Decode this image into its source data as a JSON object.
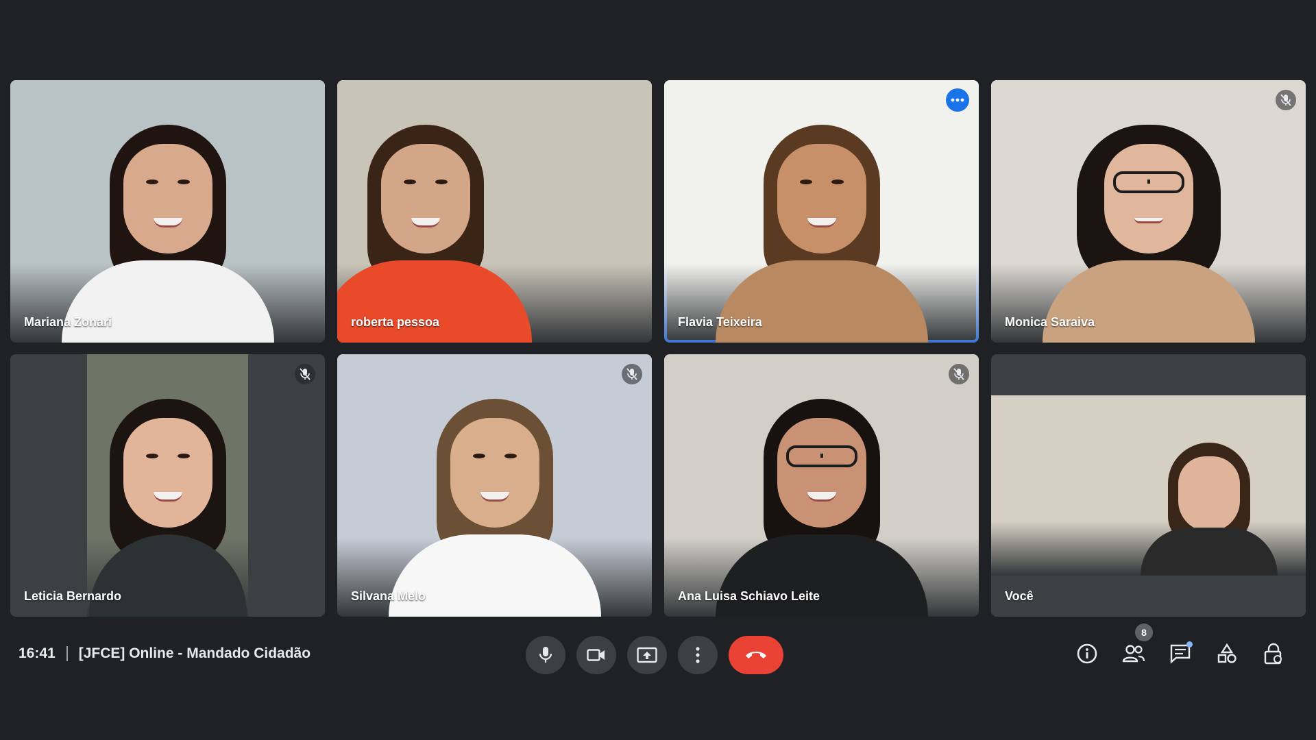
{
  "participants": [
    {
      "name": "Mariana Zonari",
      "muted": false,
      "bg": "#b9c2c4",
      "hair": "#1f1410",
      "skin": "#d9a98d",
      "clothes": "#f2f2f2"
    },
    {
      "name": "roberta pessoa",
      "muted": false,
      "bg": "#c9c4b8",
      "hair": "#3a2416",
      "skin": "#d3a688",
      "clothes": "#e84a2a"
    },
    {
      "name": "Flavia Teixeira",
      "muted": false,
      "active": true,
      "bg": "#f1f1ee",
      "hair": "#5a3b22",
      "skin": "#c89068",
      "clothes": "#b98a62"
    },
    {
      "name": "Monica Saraiva",
      "muted": true,
      "bg": "#dcd8d2",
      "hair": "#1b1411",
      "skin": "#e0b79d",
      "clothes": "#c9a27f"
    },
    {
      "name": "Leticia Bernardo",
      "muted": true,
      "bg": "#6e7466",
      "hair": "#1c1410",
      "skin": "#e2b59a",
      "clothes": "#2c3133"
    },
    {
      "name": "Silvana Melo",
      "muted": true,
      "bg": "#c6ccd6",
      "hair": "#6b5036",
      "skin": "#d8ae8c",
      "clothes": "#f7f7f7"
    },
    {
      "name": "Ana Luisa Schiavo Leite",
      "muted": true,
      "bg": "#d2cfc8",
      "hair": "#17110f",
      "skin": "#c99274",
      "clothes": "#1e1f21"
    },
    {
      "name": "Você",
      "muted": false,
      "bg": "#d6cfc4",
      "hair": "#3a2619",
      "skin": "#e0b49a",
      "clothes": "#2a2a2a"
    }
  ],
  "meeting": {
    "time": "16:41",
    "title": "[JFCE] Online - Mandado Cidadão"
  },
  "controls": {
    "mic": "microphone-icon",
    "camera": "camera-icon",
    "present": "present-screen-icon",
    "more": "more-options-icon",
    "hangup": "hang-up-icon"
  },
  "actions": {
    "participants_count": "8"
  },
  "colors": {
    "background": "#202124",
    "button": "#3c4043",
    "hangup": "#ea4335",
    "active_outline": "#4a8af4",
    "more_badge": "#1a73e8"
  }
}
